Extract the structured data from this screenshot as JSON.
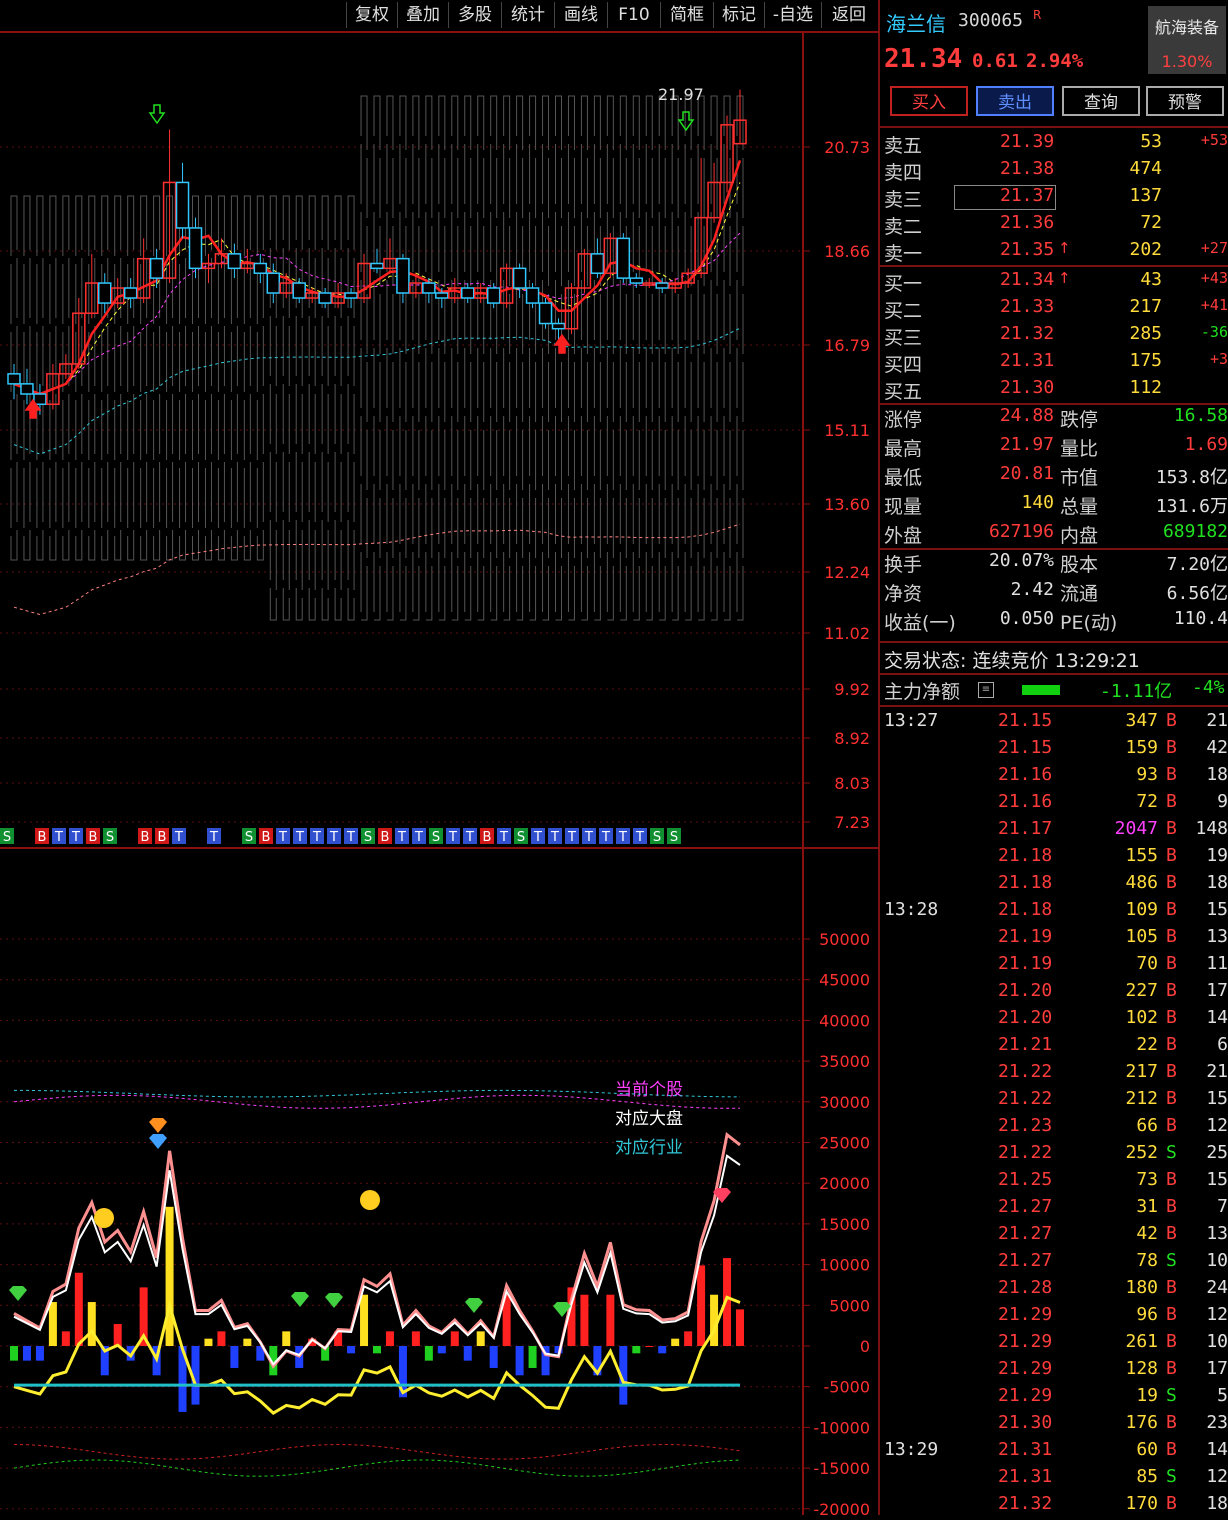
{
  "toolbar": [
    "复权",
    "叠加",
    "多股",
    "统计",
    "画线",
    "F10",
    "简框",
    "标记",
    "-自选",
    "返回"
  ],
  "stock": {
    "name": "海兰信",
    "code": "300065",
    "tag": "R",
    "price": "21.34",
    "change": "0.61",
    "change_pct": "2.94%",
    "sector_name": "航海装备",
    "sector_pct": "1.30%"
  },
  "buttons": {
    "buy": "买入",
    "sell": "卖出",
    "query": "查询",
    "alert": "预警"
  },
  "asks": [
    {
      "label": "卖五",
      "price": "21.39",
      "vol": "53",
      "chg": "+53",
      "arrow": ""
    },
    {
      "label": "卖四",
      "price": "21.38",
      "vol": "474",
      "chg": "",
      "arrow": ""
    },
    {
      "label": "卖三",
      "price": "21.37",
      "vol": "137",
      "chg": "",
      "arrow": ""
    },
    {
      "label": "卖二",
      "price": "21.36",
      "vol": "72",
      "chg": "",
      "arrow": ""
    },
    {
      "label": "卖一",
      "price": "21.35",
      "vol": "202",
      "chg": "+27",
      "arrow": "↑"
    }
  ],
  "bids": [
    {
      "label": "买一",
      "price": "21.34",
      "vol": "43",
      "chg": "+43",
      "arrow": "↑"
    },
    {
      "label": "买二",
      "price": "21.33",
      "vol": "217",
      "chg": "+41",
      "arrow": ""
    },
    {
      "label": "买三",
      "price": "21.32",
      "vol": "285",
      "chg": "-36",
      "arrow": ""
    },
    {
      "label": "买四",
      "price": "21.31",
      "vol": "175",
      "chg": "+3",
      "arrow": ""
    },
    {
      "label": "买五",
      "price": "21.30",
      "vol": "112",
      "chg": "",
      "arrow": ""
    }
  ],
  "stats": [
    {
      "l1": "涨停",
      "v1": "24.88",
      "l2": "跌停",
      "v2": "16.58"
    },
    {
      "l1": "最高",
      "v1": "21.97",
      "l2": "量比",
      "v2": "1.69"
    },
    {
      "l1": "最低",
      "v1": "20.81",
      "l2": "市值",
      "v2": "153.8亿"
    },
    {
      "l1": "现量",
      "v1": "140",
      "l2": "总量",
      "v2": "131.6万"
    },
    {
      "l1": "外盘",
      "v1": "627196",
      "l2": "内盘",
      "v2": "689182"
    }
  ],
  "stats2": [
    {
      "l1": "换手",
      "v1": "20.07%",
      "l2": "股本",
      "v2": "7.20亿"
    },
    {
      "l1": "净资",
      "v1": "2.42",
      "l2": "流通",
      "v2": "6.56亿"
    },
    {
      "l1": "收益(一)",
      "v1": "0.050",
      "l2": "PE(动)",
      "v2": "110.4"
    }
  ],
  "trade_status": "交易状态: 连续竞价 13:29:21",
  "main_force": {
    "label": "主力净额",
    "value": "-1.11亿",
    "pct": "-4%"
  },
  "ticks": [
    {
      "t": "13:27",
      "p": "21.15",
      "v": "347",
      "d": "B",
      "n": "21"
    },
    {
      "t": "",
      "p": "21.15",
      "v": "159",
      "d": "B",
      "n": "42"
    },
    {
      "t": "",
      "p": "21.16",
      "v": "93",
      "d": "B",
      "n": "18"
    },
    {
      "t": "",
      "p": "21.16",
      "v": "72",
      "d": "B",
      "n": "9"
    },
    {
      "t": "",
      "p": "21.17",
      "v": "2047",
      "d": "B",
      "n": "148"
    },
    {
      "t": "",
      "p": "21.18",
      "v": "155",
      "d": "B",
      "n": "19"
    },
    {
      "t": "",
      "p": "21.18",
      "v": "486",
      "d": "B",
      "n": "18"
    },
    {
      "t": "13:28",
      "p": "21.18",
      "v": "109",
      "d": "B",
      "n": "15"
    },
    {
      "t": "",
      "p": "21.19",
      "v": "105",
      "d": "B",
      "n": "13"
    },
    {
      "t": "",
      "p": "21.19",
      "v": "70",
      "d": "B",
      "n": "11"
    },
    {
      "t": "",
      "p": "21.20",
      "v": "227",
      "d": "B",
      "n": "17"
    },
    {
      "t": "",
      "p": "21.20",
      "v": "102",
      "d": "B",
      "n": "14"
    },
    {
      "t": "",
      "p": "21.21",
      "v": "22",
      "d": "B",
      "n": "6"
    },
    {
      "t": "",
      "p": "21.22",
      "v": "217",
      "d": "B",
      "n": "21"
    },
    {
      "t": "",
      "p": "21.22",
      "v": "212",
      "d": "B",
      "n": "15"
    },
    {
      "t": "",
      "p": "21.23",
      "v": "66",
      "d": "B",
      "n": "12"
    },
    {
      "t": "",
      "p": "21.22",
      "v": "252",
      "d": "S",
      "n": "25"
    },
    {
      "t": "",
      "p": "21.25",
      "v": "73",
      "d": "B",
      "n": "15"
    },
    {
      "t": "",
      "p": "21.27",
      "v": "31",
      "d": "B",
      "n": "7"
    },
    {
      "t": "",
      "p": "21.27",
      "v": "42",
      "d": "B",
      "n": "13"
    },
    {
      "t": "",
      "p": "21.27",
      "v": "78",
      "d": "S",
      "n": "10"
    },
    {
      "t": "",
      "p": "21.28",
      "v": "180",
      "d": "B",
      "n": "24"
    },
    {
      "t": "",
      "p": "21.29",
      "v": "96",
      "d": "B",
      "n": "12"
    },
    {
      "t": "",
      "p": "21.29",
      "v": "261",
      "d": "B",
      "n": "10"
    },
    {
      "t": "",
      "p": "21.29",
      "v": "128",
      "d": "B",
      "n": "17"
    },
    {
      "t": "",
      "p": "21.29",
      "v": "19",
      "d": "S",
      "n": "5"
    },
    {
      "t": "",
      "p": "21.30",
      "v": "176",
      "d": "B",
      "n": "23"
    },
    {
      "t": "13:29",
      "p": "21.31",
      "v": "60",
      "d": "B",
      "n": "14"
    },
    {
      "t": "",
      "p": "21.31",
      "v": "85",
      "d": "S",
      "n": "12"
    },
    {
      "t": "",
      "p": "21.32",
      "v": "170",
      "d": "B",
      "n": "18"
    }
  ],
  "chart_data": {
    "type": "line",
    "price_axis": [
      "20.73",
      "18.66",
      "16.79",
      "15.11",
      "13.60",
      "12.24",
      "11.02",
      "9.92",
      "8.92",
      "8.03",
      "7.23"
    ],
    "indicator_axis": [
      "50000",
      "45000",
      "40000",
      "35000",
      "30000",
      "25000",
      "20000",
      "15000",
      "10000",
      "5000",
      "0",
      "-5000",
      "-10000",
      "-15000",
      "-20000"
    ],
    "high_label": "21.97",
    "legend": [
      "当前个股",
      "对应大盘",
      "对应行业"
    ],
    "signal_row": "S BTTBS BBT T SBTTTTTSBTTSTTBTSTTTTTTTSS",
    "candles": [
      [
        16.2,
        16.0,
        16.4,
        15.7
      ],
      [
        16.0,
        15.8,
        16.3,
        15.6
      ],
      [
        15.8,
        15.6,
        16.0,
        15.4
      ],
      [
        15.6,
        16.2,
        16.4,
        15.5
      ],
      [
        16.2,
        16.4,
        16.6,
        16.1
      ],
      [
        16.4,
        17.4,
        17.7,
        16.3
      ],
      [
        17.4,
        18.0,
        18.6,
        17.3
      ],
      [
        18.0,
        17.6,
        18.2,
        17.4
      ],
      [
        17.6,
        17.9,
        18.1,
        17.5
      ],
      [
        17.9,
        17.7,
        18.1,
        17.5
      ],
      [
        17.7,
        18.5,
        18.9,
        17.6
      ],
      [
        18.5,
        18.1,
        18.7,
        17.9
      ],
      [
        18.1,
        20.0,
        21.1,
        18.0
      ],
      [
        20.0,
        19.1,
        20.4,
        18.9
      ],
      [
        19.1,
        18.3,
        19.3,
        18.1
      ],
      [
        18.3,
        18.4,
        18.6,
        18.0
      ],
      [
        18.4,
        18.6,
        18.9,
        18.3
      ],
      [
        18.6,
        18.3,
        18.8,
        18.1
      ],
      [
        18.3,
        18.4,
        18.7,
        18.2
      ],
      [
        18.4,
        18.2,
        18.6,
        18.0
      ],
      [
        18.2,
        17.8,
        18.4,
        17.6
      ],
      [
        17.8,
        18.0,
        18.2,
        17.7
      ],
      [
        18.0,
        17.7,
        18.1,
        17.6
      ],
      [
        17.7,
        17.8,
        17.9,
        17.6
      ],
      [
        17.8,
        17.6,
        17.9,
        17.5
      ],
      [
        17.6,
        17.8,
        18.0,
        17.5
      ],
      [
        17.8,
        17.7,
        17.9,
        17.5
      ],
      [
        17.7,
        18.4,
        18.6,
        17.6
      ],
      [
        18.4,
        18.3,
        18.7,
        18.2
      ],
      [
        18.3,
        18.5,
        18.9,
        18.2
      ],
      [
        18.5,
        17.8,
        18.6,
        17.6
      ],
      [
        17.8,
        18.0,
        18.2,
        17.7
      ],
      [
        18.0,
        17.8,
        18.1,
        17.6
      ],
      [
        17.8,
        17.7,
        17.9,
        17.5
      ],
      [
        17.7,
        17.9,
        18.1,
        17.6
      ],
      [
        17.9,
        17.7,
        18.0,
        17.6
      ],
      [
        17.7,
        17.9,
        18.0,
        17.6
      ],
      [
        17.9,
        17.6,
        18.0,
        17.5
      ],
      [
        17.6,
        18.3,
        18.4,
        17.5
      ],
      [
        18.3,
        17.9,
        18.4,
        17.7
      ],
      [
        17.9,
        17.6,
        18.0,
        17.5
      ],
      [
        17.6,
        17.2,
        17.7,
        17.1
      ],
      [
        17.2,
        17.1,
        17.3,
        16.9
      ],
      [
        17.1,
        17.9,
        18.0,
        17.0
      ],
      [
        17.9,
        18.6,
        18.7,
        17.8
      ],
      [
        18.6,
        18.2,
        18.9,
        18.1
      ],
      [
        18.2,
        18.9,
        19.0,
        18.1
      ],
      [
        18.9,
        18.1,
        19.0,
        18.0
      ],
      [
        18.1,
        18.0,
        18.2,
        17.9
      ],
      [
        18.0,
        18.0,
        18.1,
        17.9
      ],
      [
        18.0,
        17.9,
        18.1,
        17.8
      ],
      [
        17.9,
        18.0,
        18.1,
        17.8
      ],
      [
        18.0,
        18.2,
        18.3,
        17.9
      ],
      [
        18.2,
        19.3,
        20.5,
        18.1
      ],
      [
        19.3,
        20.0,
        20.4,
        19.2
      ],
      [
        20.0,
        21.2,
        21.4,
        19.8
      ],
      [
        20.8,
        21.3,
        21.97,
        20.81
      ]
    ]
  }
}
